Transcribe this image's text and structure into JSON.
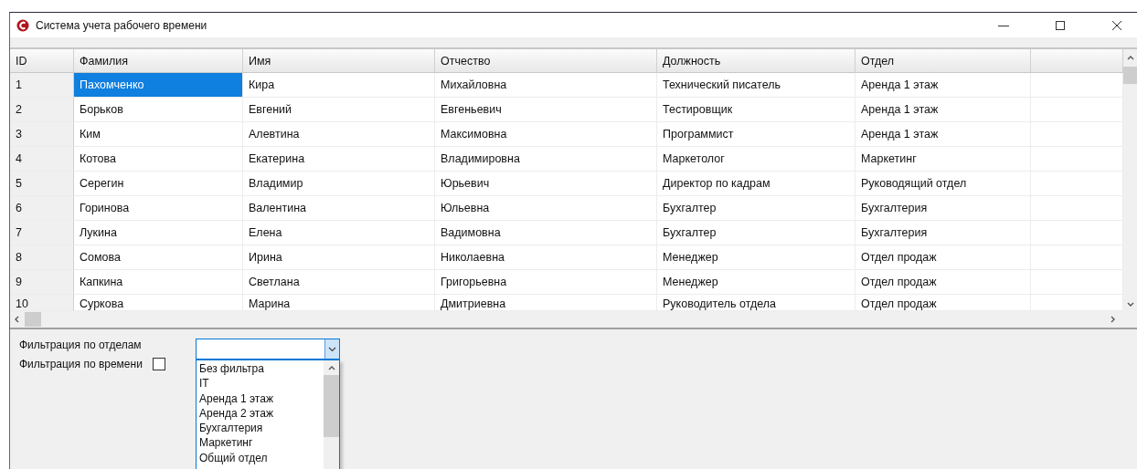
{
  "window": {
    "title": "Система учета рабочего времени"
  },
  "table": {
    "columns": [
      "ID",
      "Фамилия",
      "Имя",
      "Отчество",
      "Должность",
      "Отдел"
    ],
    "rows": [
      {
        "cells": [
          {
            "text": "1",
            "selected": false
          },
          {
            "text": "Пахомченко",
            "selected": true
          },
          {
            "text": "Кира",
            "selected": false
          },
          {
            "text": "Михайловна",
            "selected": false
          },
          {
            "text": "Технический писатель",
            "selected": false
          },
          {
            "text": "Аренда 1 этаж",
            "selected": false
          }
        ]
      },
      {
        "cells": [
          {
            "text": "2",
            "selected": false
          },
          {
            "text": "Борьков",
            "selected": false
          },
          {
            "text": "Евгений",
            "selected": false
          },
          {
            "text": "Евгеньевич",
            "selected": false
          },
          {
            "text": "Тестировщик",
            "selected": false
          },
          {
            "text": "Аренда 1 этаж",
            "selected": false
          }
        ]
      },
      {
        "cells": [
          {
            "text": "3",
            "selected": false
          },
          {
            "text": "Ким",
            "selected": false
          },
          {
            "text": "Алевтина",
            "selected": false
          },
          {
            "text": "Максимовна",
            "selected": false
          },
          {
            "text": "Программист",
            "selected": false
          },
          {
            "text": "Аренда 1 этаж",
            "selected": false
          }
        ]
      },
      {
        "cells": [
          {
            "text": "4",
            "selected": false
          },
          {
            "text": "Котова",
            "selected": false
          },
          {
            "text": "Екатерина",
            "selected": false
          },
          {
            "text": "Владимировна",
            "selected": false
          },
          {
            "text": "Маркетолог",
            "selected": false
          },
          {
            "text": "Маркетинг",
            "selected": false
          }
        ]
      },
      {
        "cells": [
          {
            "text": "5",
            "selected": false
          },
          {
            "text": "Серегин",
            "selected": false
          },
          {
            "text": "Владимир",
            "selected": false
          },
          {
            "text": "Юрьевич",
            "selected": false
          },
          {
            "text": "Директор по кадрам",
            "selected": false
          },
          {
            "text": "Руководящий отдел",
            "selected": false
          }
        ]
      },
      {
        "cells": [
          {
            "text": "6",
            "selected": false
          },
          {
            "text": "Горинова",
            "selected": false
          },
          {
            "text": "Валентина",
            "selected": false
          },
          {
            "text": "Юльевна",
            "selected": false
          },
          {
            "text": "Бухгалтер",
            "selected": false
          },
          {
            "text": "Бухгалтерия",
            "selected": false
          }
        ]
      },
      {
        "cells": [
          {
            "text": "7",
            "selected": false
          },
          {
            "text": "Лукина",
            "selected": false
          },
          {
            "text": "Елена",
            "selected": false
          },
          {
            "text": "Вадимовна",
            "selected": false
          },
          {
            "text": "Бухгалтер",
            "selected": false
          },
          {
            "text": "Бухгалтерия",
            "selected": false
          }
        ]
      },
      {
        "cells": [
          {
            "text": "8",
            "selected": false
          },
          {
            "text": "Сомова",
            "selected": false
          },
          {
            "text": "Ирина",
            "selected": false
          },
          {
            "text": "Николаевна",
            "selected": false
          },
          {
            "text": "Менеджер",
            "selected": false
          },
          {
            "text": "Отдел продаж",
            "selected": false
          }
        ]
      },
      {
        "cells": [
          {
            "text": "9",
            "selected": false
          },
          {
            "text": "Капкина",
            "selected": false
          },
          {
            "text": "Светлана",
            "selected": false
          },
          {
            "text": "Григорьевна",
            "selected": false
          },
          {
            "text": "Менеджер",
            "selected": false
          },
          {
            "text": "Отдел продаж",
            "selected": false
          }
        ]
      },
      {
        "cells": [
          {
            "text": "10",
            "selected": false
          },
          {
            "text": "Суркова",
            "selected": false
          },
          {
            "text": "Марина",
            "selected": false
          },
          {
            "text": "Дмитриевна",
            "selected": false
          },
          {
            "text": "Руководитель отдела",
            "selected": false
          },
          {
            "text": "Отдел продаж",
            "selected": false
          }
        ]
      }
    ]
  },
  "filters": {
    "department_label": "Фильтрация по отделам",
    "time_label": "Фильтрация по времени",
    "time_checked": false,
    "department_options": [
      "Без фильтра",
      "IT",
      "Аренда 1 этаж",
      "Аренда 2 этаж",
      "Бухгалтерия",
      "Маркетинг",
      "Общий отдел"
    ]
  }
}
